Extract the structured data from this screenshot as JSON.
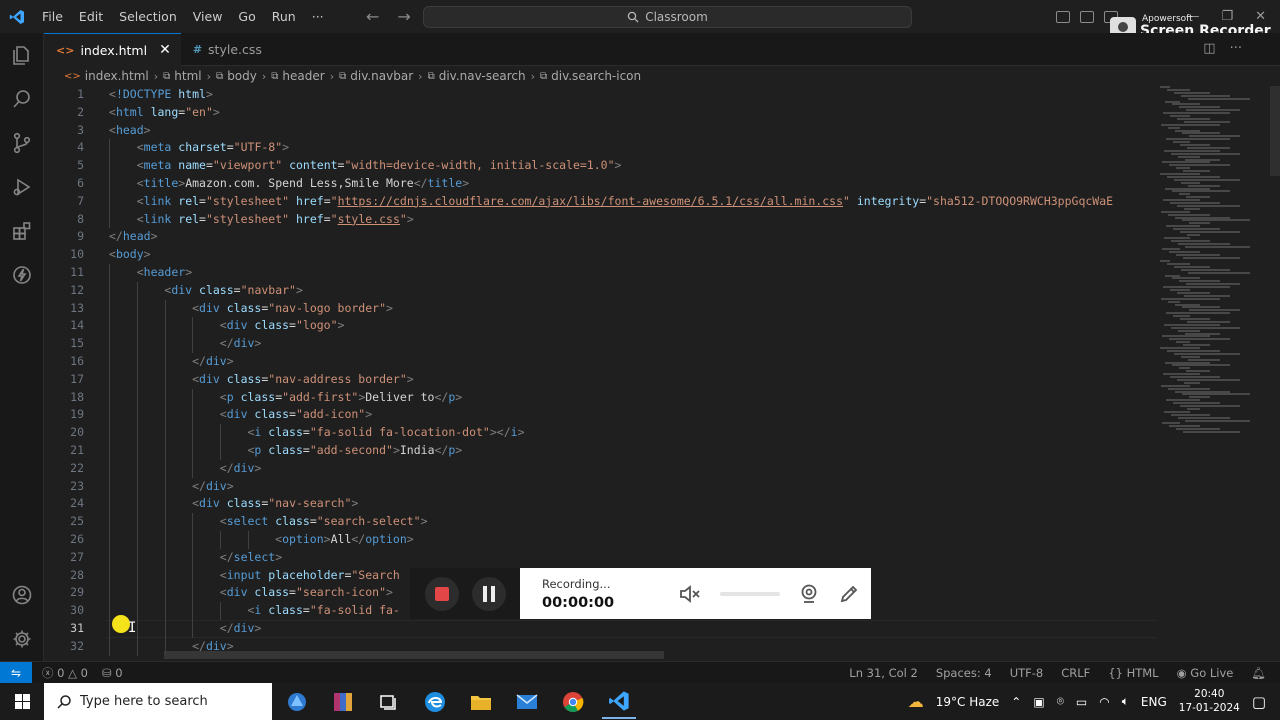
{
  "window": {
    "menu": [
      "File",
      "Edit",
      "Selection",
      "View",
      "Go",
      "Run",
      "···"
    ],
    "command_center": "Classroom"
  },
  "watermark": {
    "small": "Apowersoft",
    "big": "Screen Recorder"
  },
  "tabs": [
    {
      "label": "index.html",
      "active": true
    },
    {
      "label": "style.css",
      "active": false
    }
  ],
  "breadcrumb": [
    "index.html",
    "html",
    "body",
    "header",
    "div.navbar",
    "div.nav-search",
    "div.search-icon"
  ],
  "editor": {
    "current_line": 31,
    "line_numbers": [
      "1",
      "2",
      "3",
      "4",
      "5",
      "6",
      "7",
      "8",
      "9",
      "10",
      "11",
      "12",
      "13",
      "14",
      "15",
      "16",
      "17",
      "18",
      "19",
      "20",
      "21",
      "22",
      "23",
      "24",
      "25",
      "26",
      "27",
      "28",
      "29",
      "30",
      "31",
      "32"
    ],
    "lines": [
      "<!DOCTYPE html>",
      "<html lang=\"en\">",
      "<head>",
      "    <meta charset=\"UTF-8\">",
      "    <meta name=\"viewport\" content=\"width=device-width, initial-scale=1.0\">",
      "    <title>Amazon.com. Spend Less,Smile More</title>",
      "    <link rel=\"stylesheet\" href=\"https://cdnjs.cloudflare.com/ajax/libs/font-awesome/6.5.1/css/all.min.css\" integrity=\"sha512-DTOQO9RWCH3ppGqcWaE",
      "    <link rel=\"stylesheet\" href=\"style.css\">",
      "</head>",
      "<body>",
      "    <header>",
      "        <div class=\"navbar\">",
      "            <div class=\"nav-logo border\">",
      "                <div class=\"logo\">",
      "                </div>",
      "            </div>",
      "            <div class=\"nav-address border\">",
      "                <p class=\"add-first\">Deliver to</p>",
      "                <div class=\"add-icon\">",
      "                    <i class=\"fa-solid fa-location-dot\"></i>",
      "                    <p class=\"add-second\">India</p>",
      "                </div>",
      "            </div>",
      "            <div class=\"nav-search\">",
      "                <select class=\"search-select\">",
      "                        <option>All</option>",
      "                </select>",
      "                <input placeholder=\"Search",
      "                <div class=\"search-icon\">",
      "                    <i class=\"fa-solid fa-",
      "                </div>",
      "            </div>"
    ]
  },
  "recorder": {
    "status": "Recording...",
    "time": "00:00:00"
  },
  "status_bar": {
    "errors": "0",
    "warnings": "0",
    "ports": "0",
    "position": "Ln 31, Col 2",
    "spaces": "Spaces: 4",
    "encoding": "UTF-8",
    "eol": "CRLF",
    "language": "HTML",
    "golive": "Go Live"
  },
  "taskbar": {
    "search_placeholder": "Type here to search",
    "weather": "19°C  Haze",
    "lang": "ENG",
    "time": "20:40",
    "date": "17-01-2024"
  }
}
